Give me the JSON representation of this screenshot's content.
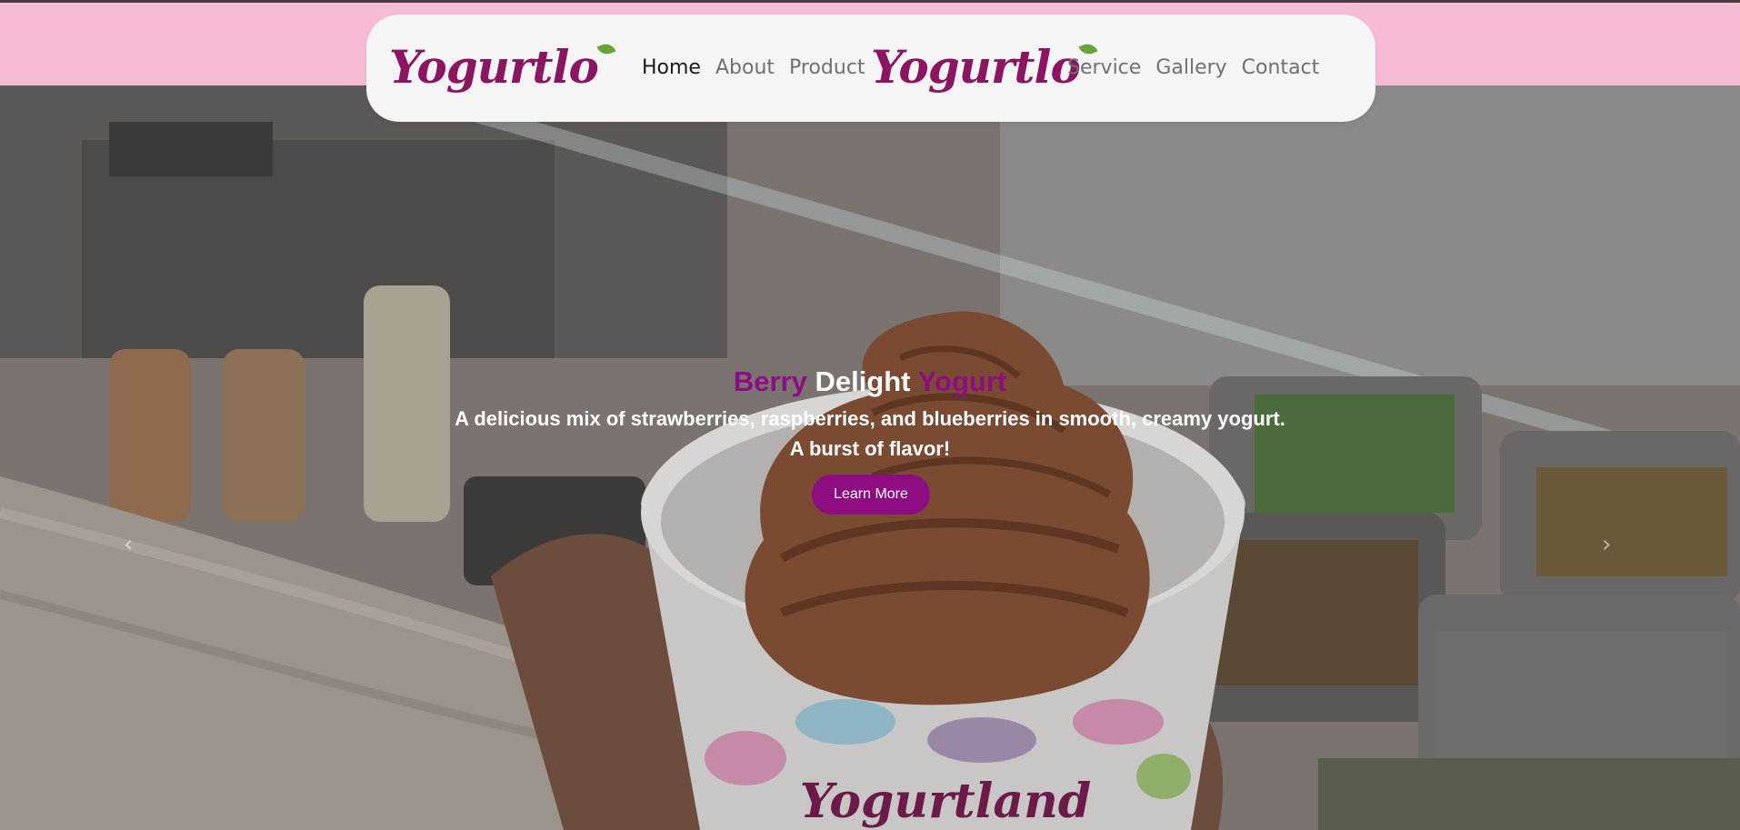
{
  "nav": {
    "logo_left_text": "Yogurtlo",
    "logo_center_text": "Yogurtlo",
    "links_left": [
      "Home",
      "About",
      "Product"
    ],
    "links_right": [
      "Service",
      "Gallery",
      "Contact"
    ]
  },
  "hero": {
    "title_word1": "Berry",
    "title_word2": "Delight",
    "title_word3": "Yogurt",
    "description_line1": "A delicious mix of strawberries, raspberries, and blueberries in smooth, creamy yogurt.",
    "description_line2": "A burst of flavor!",
    "button_label": "Learn More",
    "prev_icon": "‹",
    "next_icon": "›",
    "cup_brand": "Yogurtland"
  },
  "colors": {
    "brand_purple": "#8e0d82",
    "logo_magenta": "#8b1560",
    "band_pink": "#f8bbd6"
  }
}
